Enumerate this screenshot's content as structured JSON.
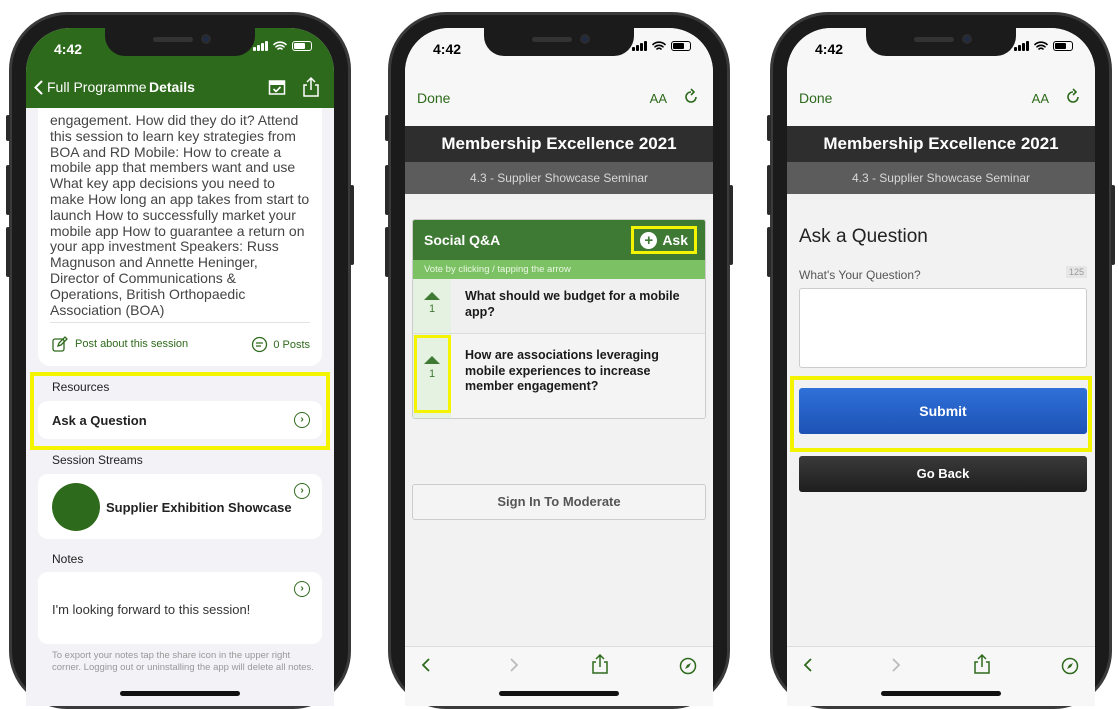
{
  "colors": {
    "brand_green": "#2e6a1c",
    "highlight": "#f4f400",
    "submit_blue": "#2e71d8"
  },
  "phone1": {
    "status_time": "4:42",
    "nav": {
      "back_label": "Full Programme",
      "title": "Details",
      "calendar_icon": "calendar-check-icon",
      "share_icon": "share-icon"
    },
    "description": "engagement. How did they do it? Attend this session to learn key strategies from BOA and RD Mobile: How to create a mobile app that members want and use What key app decisions you need to make How long an app takes from start to launch How to successfully market your mobile app How to guarantee a return on your app investment Speakers: Russ Magnuson and Annette Heninger, Director of Communications & Operations, British Orthopaedic Association (BOA)",
    "post_label": "Post about this session",
    "posts_count": "0 Posts",
    "resources_heading": "Resources",
    "ask_question_label": "Ask a Question",
    "streams_heading": "Session Streams",
    "stream_label": "Supplier Exhibition Showcase",
    "notes_heading": "Notes",
    "note_text": "I'm looking forward to this session!",
    "footer": "To export your notes tap the share icon in the upper right corner. Logging out or uninstalling the app will delete all notes."
  },
  "phone2": {
    "status_time": "4:42",
    "done_label": "Done",
    "text_size_label": "AA",
    "event_title": "Membership Excellence 2021",
    "session_subtitle": "4.3 - Supplier Showcase Seminar",
    "qa": {
      "title": "Social Q&A",
      "ask_label": "Ask",
      "hint": "Vote by clicking / tapping the arrow",
      "questions": [
        {
          "text": "What should we budget for a mobile app?",
          "votes": "1"
        },
        {
          "text": "How are associations leveraging mobile experiences to increase member engagement?",
          "votes": "1"
        }
      ]
    },
    "moderate_label": "Sign In To Moderate"
  },
  "phone3": {
    "status_time": "4:42",
    "done_label": "Done",
    "text_size_label": "AA",
    "event_title": "Membership Excellence 2021",
    "session_subtitle": "4.3 - Supplier Showcase Seminar",
    "form_title": "Ask a Question",
    "field_label": "What's Your Question?",
    "char_count": "125",
    "textarea_value": "",
    "submit_label": "Submit",
    "goback_label": "Go Back"
  }
}
